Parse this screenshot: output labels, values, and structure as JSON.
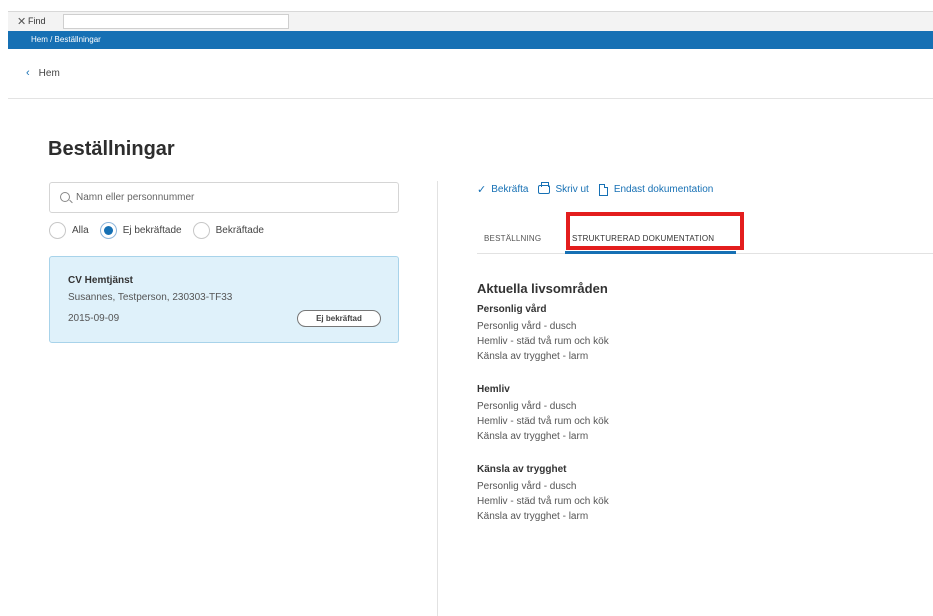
{
  "find_bar": {
    "close_glyph": "✕",
    "label": "Find",
    "value": ""
  },
  "breadcrumb": "Hem / Beställningar",
  "back_link": "Hem",
  "page_title": "Beställningar",
  "search": {
    "placeholder": "Namn eller personnummer"
  },
  "filters": [
    {
      "label": "Alla",
      "selected": false
    },
    {
      "label": "Ej bekräftade",
      "selected": true
    },
    {
      "label": "Bekräftade",
      "selected": false
    }
  ],
  "order_card": {
    "title": "CV Hemtjänst",
    "subtitle": "Susannes, Testperson, 230303-TF33",
    "date": "2015-09-09",
    "badge": "Ej bekräftad"
  },
  "actions": {
    "confirm": "Bekräfta",
    "print": "Skriv ut",
    "docs_only": "Endast dokumentation"
  },
  "tabs": [
    {
      "label": "BESTÄLLNING",
      "active": false
    },
    {
      "label": "STRUKTURERAD DOKUMENTATION",
      "active": true
    }
  ],
  "content": {
    "section_title": "Aktuella livsområden",
    "groups": [
      {
        "title": "Personlig vård",
        "items": [
          "Personlig vård - dusch",
          "Hemliv - städ två rum och kök",
          "Känsla av trygghet - larm"
        ]
      },
      {
        "title": "Hemliv",
        "items": [
          "Personlig vård - dusch",
          "Hemliv - städ två rum och kök",
          "Känsla av trygghet - larm"
        ]
      },
      {
        "title": "Känsla av trygghet",
        "items": [
          "Personlig vård - dusch",
          "Hemliv - städ två rum och kök",
          "Känsla av trygghet - larm"
        ]
      }
    ]
  },
  "colors": {
    "brand_blue": "#1670b4",
    "card_bg": "#dff1fa",
    "highlight_red": "#e31d1d"
  }
}
